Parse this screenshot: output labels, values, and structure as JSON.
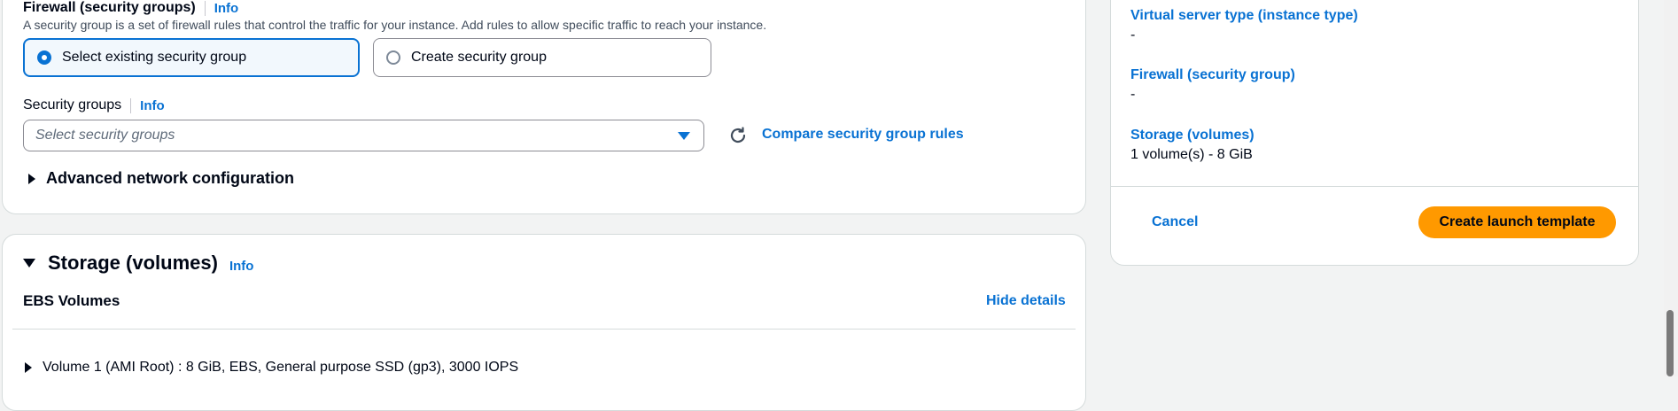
{
  "firewall": {
    "title": "Firewall (security groups)",
    "info": "Info",
    "description": "A security group is a set of firewall rules that control the traffic for your instance. Add rules to allow specific traffic to reach your instance.",
    "option_existing": "Select existing security group",
    "option_create": "Create security group",
    "selected": "Select existing security group"
  },
  "security_groups": {
    "label": "Security groups",
    "info": "Info",
    "placeholder": "Select security groups",
    "compare_link": "Compare security group rules"
  },
  "advanced": {
    "label": "Advanced network configuration"
  },
  "storage": {
    "title": "Storage (volumes)",
    "info": "Info",
    "ebs_title": "EBS Volumes",
    "hide_details": "Hide details",
    "volume_1": "Volume 1 (AMI Root) : 8 GiB, EBS, General purpose SSD (gp3), 3000 IOPS"
  },
  "summary": {
    "instance_type_label": "Virtual server type (instance type)",
    "instance_type_value": "-",
    "firewall_label": "Firewall (security group)",
    "firewall_value": "-",
    "storage_label": "Storage (volumes)",
    "storage_value": "1 volume(s) - 8 GiB",
    "cancel": "Cancel",
    "create": "Create launch template"
  },
  "colors": {
    "accent": "#0972d3",
    "primary_button": "#ff9900",
    "background": "#f2f3f3"
  }
}
